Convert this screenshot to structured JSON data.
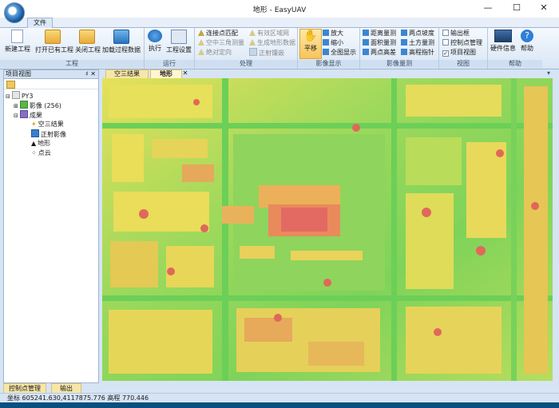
{
  "window": {
    "title": "地形 - EasyUAV",
    "minimize": "—",
    "maximize": "☐",
    "close": "✕"
  },
  "ribbon_tabs": {
    "file": "文件"
  },
  "groups": {
    "project": {
      "label": "工程",
      "buttons": [
        "新建工程",
        "打开已有工程",
        "关闭工程",
        "加载过程数据"
      ]
    },
    "run": {
      "label": "运行",
      "buttons": [
        "执行",
        "工程设置"
      ]
    },
    "process": {
      "label": "处理",
      "col1": [
        "连接点匹配",
        "空中三角测量",
        "绝对定向"
      ],
      "col2": [
        "有效区域网",
        "生成地形数据",
        "正射镶嵌"
      ]
    },
    "display": {
      "label": "影像显示",
      "pan": "平移",
      "items": [
        "放大",
        "缩小",
        "全图显示"
      ]
    },
    "measure": {
      "label": "影像量测",
      "col1": [
        "距离量测",
        "面积量测",
        "两点高差"
      ],
      "col2": [
        "两点坡度",
        "土方量测",
        "高程指针"
      ]
    },
    "view": {
      "label": "视图",
      "items": [
        "输出框",
        "控制点管理",
        "项目视图"
      ]
    },
    "help": {
      "label": "帮助",
      "hw": "硬件信息",
      "help": "帮助"
    }
  },
  "project_pane": {
    "title": "项目视图",
    "pin": "♯ ✕",
    "tree": [
      {
        "label": "PY3",
        "level": 0
      },
      {
        "label": "影像 (256)",
        "level": 1
      },
      {
        "label": "成果",
        "level": 1
      },
      {
        "label": "空三结果",
        "level": 2
      },
      {
        "label": "正射影像",
        "level": 2
      },
      {
        "label": "地形",
        "level": 2
      },
      {
        "label": "点云",
        "level": 2
      }
    ]
  },
  "doc_tabs": [
    {
      "label": "空三结果"
    },
    {
      "label": "地形"
    }
  ],
  "doc_tab_close": "✕",
  "bottom_tabs": [
    "控制点管理",
    "输出"
  ],
  "status": {
    "text": "坐标 605241.630,4117875.776 高程 770.446"
  },
  "colors": {
    "ribbon_bg": "#d9e6f5",
    "map_green": "#7fd35a",
    "map_yellow": "#e8e45a",
    "map_red": "#e0685a"
  }
}
